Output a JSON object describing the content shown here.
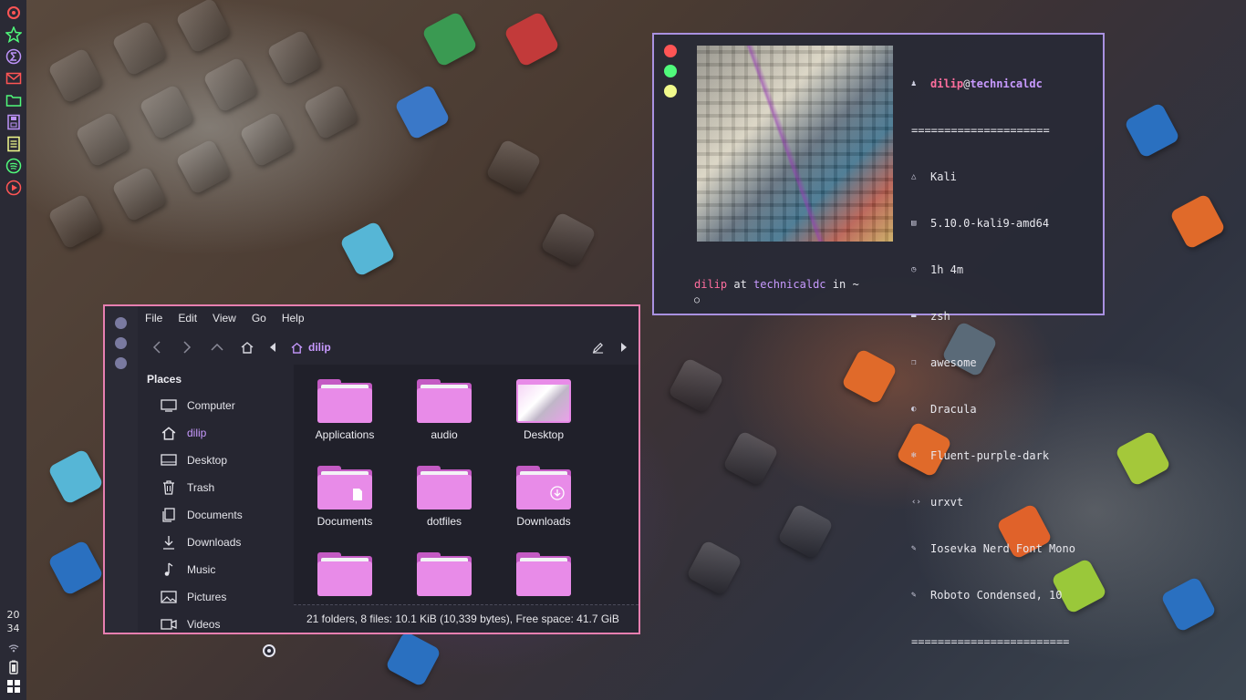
{
  "panel": {
    "apps": [
      "debian-swirl-icon",
      "star-icon",
      "sigma-icon",
      "mail-icon",
      "folder-icon",
      "floppy-icon",
      "notes-icon",
      "spotify-icon",
      "play-icon"
    ],
    "clock": {
      "hour": "20",
      "minute": "34"
    },
    "tray": [
      "wifi-icon",
      "battery-icon",
      "grid-icon"
    ]
  },
  "terminal": {
    "buttons": [
      {
        "name": "close-button",
        "color": "#ff5555"
      },
      {
        "name": "maximize-button",
        "color": "#50fa7b"
      },
      {
        "name": "minimize-button",
        "color": "#f1fa8c"
      }
    ],
    "user": "dilip",
    "at": "@",
    "host": "technicaldc",
    "separator_top": "=====================",
    "info": [
      {
        "icon": "os-icon",
        "glyph": "△",
        "text": "Kali"
      },
      {
        "icon": "kernel-icon",
        "glyph": "▤",
        "text": "5.10.0-kali9-amd64"
      },
      {
        "icon": "uptime-icon",
        "glyph": "◷",
        "text": "1h 4m"
      },
      {
        "icon": "shell-icon",
        "glyph": "▬",
        "text": "zsh"
      },
      {
        "icon": "wm-icon",
        "glyph": "❐",
        "text": "awesome"
      },
      {
        "icon": "theme-icon",
        "glyph": "◐",
        "text": "Dracula"
      },
      {
        "icon": "icons-icon",
        "glyph": "❄",
        "text": "Fluent-purple-dark"
      },
      {
        "icon": "terminal-icon",
        "glyph": "‹›",
        "text": "urxvt"
      },
      {
        "icon": "term-font-icon",
        "glyph": "✎",
        "text": "Iosevka Nerd Font Mono"
      },
      {
        "icon": "font-icon",
        "glyph": "✎",
        "text": "Roboto Condensed, 10"
      }
    ],
    "separator_bottom": "========================",
    "prompt": {
      "user": "dilip",
      "at": "at",
      "host": "technicaldc",
      "in": "in",
      "dir": "~",
      "symbol": "○"
    }
  },
  "filemanager": {
    "menu": [
      "File",
      "Edit",
      "View",
      "Go",
      "Help"
    ],
    "location": "dilip",
    "places_header": "Places",
    "places": [
      {
        "label": "Computer",
        "icon": "computer-icon"
      },
      {
        "label": "dilip",
        "icon": "home-icon",
        "active": true
      },
      {
        "label": "Desktop",
        "icon": "desktop-icon"
      },
      {
        "label": "Trash",
        "icon": "trash-icon"
      },
      {
        "label": "Documents",
        "icon": "documents-icon"
      },
      {
        "label": "Downloads",
        "icon": "downloads-icon"
      },
      {
        "label": "Music",
        "icon": "music-icon"
      },
      {
        "label": "Pictures",
        "icon": "pictures-icon"
      },
      {
        "label": "Videos",
        "icon": "videos-icon"
      }
    ],
    "items": [
      {
        "label": "Applications"
      },
      {
        "label": "audio"
      },
      {
        "label": "Desktop"
      },
      {
        "label": "Documents"
      },
      {
        "label": "dotfiles"
      },
      {
        "label": "Downloads"
      },
      {
        "label": ""
      },
      {
        "label": ""
      },
      {
        "label": ""
      }
    ],
    "status": "21 folders, 8 files: 10.1 KiB (10,339 bytes), Free space: 41.7 GiB",
    "colors": {
      "accent": "#c89aff",
      "border": "#e77fb0",
      "folder": "#e88be8"
    }
  }
}
